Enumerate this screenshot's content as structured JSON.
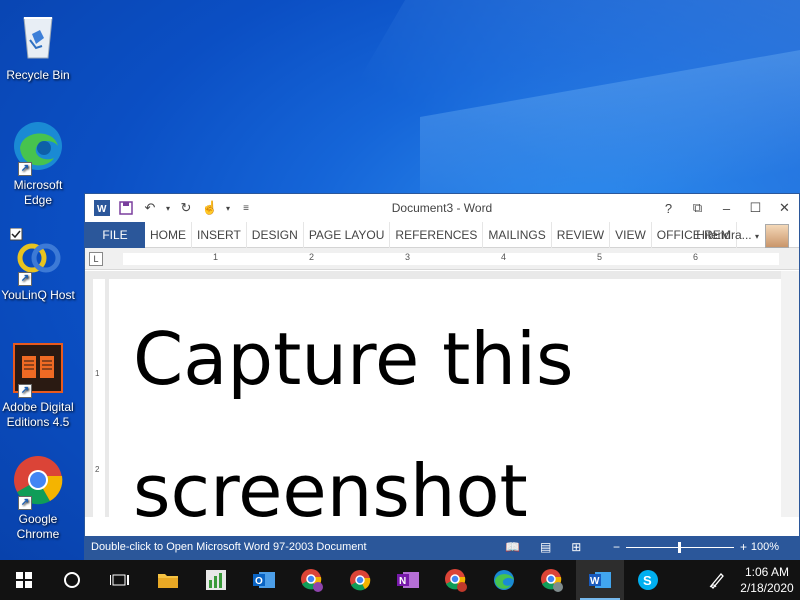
{
  "desktop": {
    "icons": [
      {
        "label": "Recycle Bin"
      },
      {
        "label": "Microsoft Edge"
      },
      {
        "label": "YouLinQ Host"
      },
      {
        "label": "Adobe Digital Editions 4.5"
      },
      {
        "label": "Google Chrome"
      }
    ]
  },
  "word": {
    "title": "Document3 - Word",
    "help": "?",
    "tabs": [
      "FILE",
      "HOME",
      "INSERT",
      "DESIGN",
      "PAGE LAYOU",
      "REFERENCES",
      "MAILINGS",
      "REVIEW",
      "VIEW",
      "OFFICE REM"
    ],
    "user": "Hitendra...",
    "ruler_marks": [
      "1",
      "2",
      "3",
      "4",
      "5",
      "6"
    ],
    "vruler_marks": [
      "1",
      "2"
    ],
    "document_text_line1": "Capture this",
    "document_text_line2": "screenshot",
    "status_message": "Double-click to Open Microsoft Word 97-2003 Document",
    "zoom_minus": "−",
    "zoom_plus": "+",
    "zoom": "100%"
  },
  "taskbar": {
    "time": "1:06 AM",
    "date": "2/18/2020"
  },
  "colors": {
    "word_blue": "#2b579a",
    "taskbar": "#121212"
  }
}
